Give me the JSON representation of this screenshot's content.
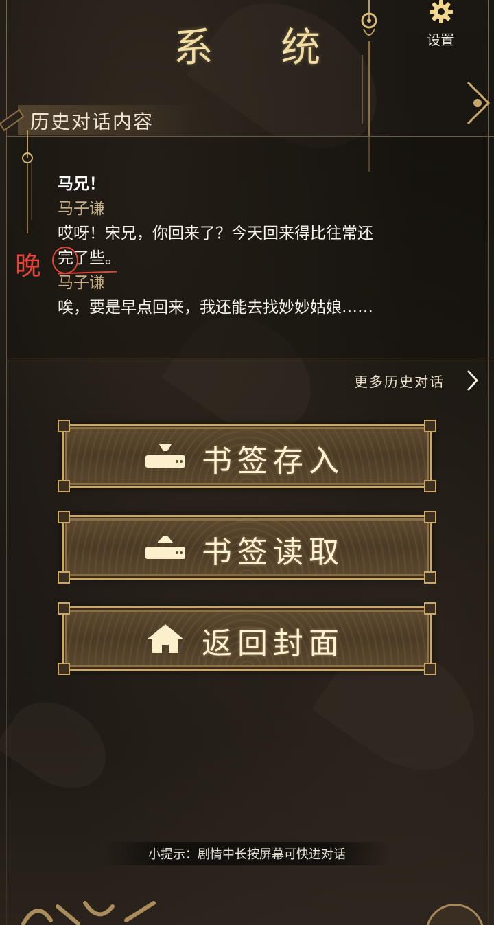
{
  "header": {
    "title": "系 统",
    "settings_label": "设置"
  },
  "history": {
    "section_title": "历史对话内容",
    "lines": [
      {
        "kind": "text-bold",
        "text": "马兄！"
      },
      {
        "kind": "speaker",
        "text": "马子谦"
      },
      {
        "kind": "text",
        "text": "哎呀！宋兄，你回来了？今天回来得比往常还"
      },
      {
        "kind": "text",
        "text": "完了些。"
      },
      {
        "kind": "speaker",
        "text": "马子谦"
      },
      {
        "kind": "text",
        "text": "唉，要是早点回来，我还能去找妙妙姑娘……"
      }
    ],
    "annotation": "晚",
    "more_label": "更多历史对话"
  },
  "buttons": {
    "save_label": "书签存入",
    "load_label": "书签读取",
    "home_label": "返回封面"
  },
  "tip": "小提示：剧情中长按屏幕可快进对话",
  "icons": {
    "settings": "gear-icon",
    "more": "chevron-right-icon",
    "save": "bookmark-save-icon",
    "load": "bookmark-load-icon",
    "home": "home-icon"
  },
  "colors": {
    "gold": "#c9a86a",
    "title": "#f1dda4",
    "speaker": "#c7b088",
    "annotation": "#e0443a"
  }
}
